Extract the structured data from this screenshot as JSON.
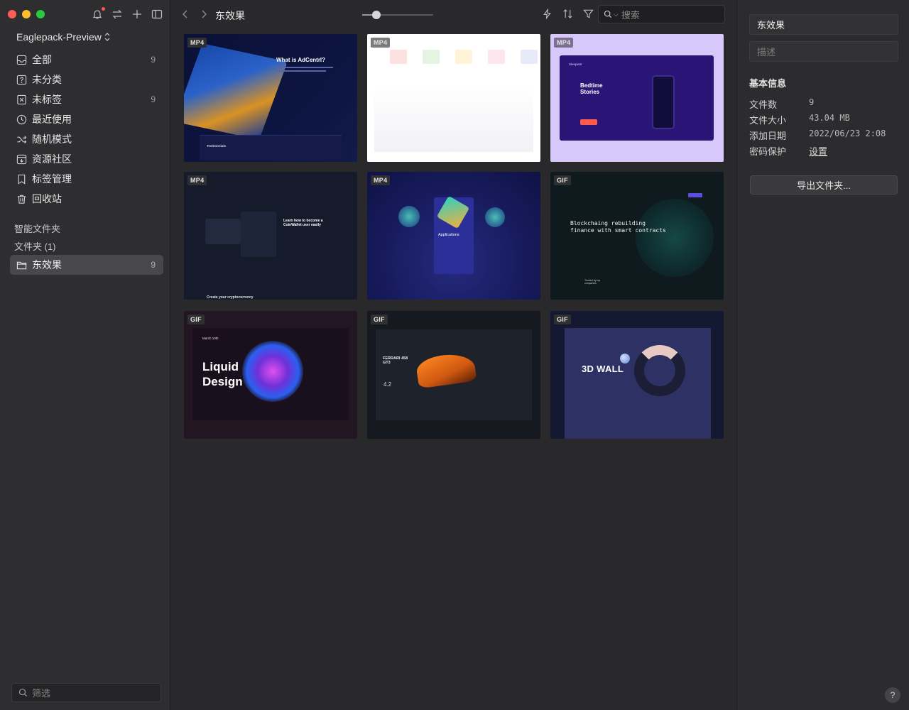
{
  "sidebar": {
    "library_name": "Eaglepack-Preview",
    "nav": [
      {
        "label": "全部",
        "count": "9",
        "icon": "inbox-icon"
      },
      {
        "label": "未分类",
        "count": "",
        "icon": "question-box-icon"
      },
      {
        "label": "未标签",
        "count": "9",
        "icon": "untagged-icon"
      },
      {
        "label": "最近使用",
        "count": "",
        "icon": "clock-icon"
      },
      {
        "label": "随机模式",
        "count": "",
        "icon": "shuffle-icon"
      },
      {
        "label": "资源社区",
        "count": "",
        "icon": "community-icon"
      },
      {
        "label": "标签管理",
        "count": "",
        "icon": "bookmark-icon"
      },
      {
        "label": "回收站",
        "count": "",
        "icon": "trash-icon"
      }
    ],
    "smart_folders_label": "智能文件夹",
    "folders_label": "文件夹 (1)",
    "folder": {
      "label": "东效果",
      "count": "9"
    },
    "filter_placeholder": "筛选"
  },
  "toolbar": {
    "title": "东效果",
    "search_placeholder": "搜索"
  },
  "thumbnails": [
    {
      "badge": "MP4",
      "heading": "What is AdCentrl?",
      "sub": "Testimonials"
    },
    {
      "badge": "MP4",
      "heading": "",
      "sub": ""
    },
    {
      "badge": "MP4",
      "heading": "Bedtime Stories",
      "sub": "Sleepiest"
    },
    {
      "badge": "MP4",
      "heading": "Learn how to become a CoinWallet user easily",
      "sub": "Create your cryptocurrency"
    },
    {
      "badge": "MP4",
      "heading": "Applications",
      "sub": ""
    },
    {
      "badge": "GIF",
      "heading": "Blockchaing rebuilding finance with smart contracts",
      "sub": "Trusted by top companies"
    },
    {
      "badge": "GIF",
      "heading": "Liquid Design",
      "sub": "March 10th"
    },
    {
      "badge": "GIF",
      "heading": "FERRARI 458 GT3",
      "sub": "4.2"
    },
    {
      "badge": "GIF",
      "heading": "3D WALL",
      "sub": ""
    }
  ],
  "info": {
    "name_value": "东效果",
    "desc_placeholder": "描述",
    "section_title": "基本信息",
    "rows": [
      {
        "key": "文件数",
        "value": "9"
      },
      {
        "key": "文件大小",
        "value": "43.04 MB"
      },
      {
        "key": "添加日期",
        "value": "2022/06/23 2:08"
      },
      {
        "key": "密码保护",
        "value": "设置"
      }
    ],
    "export_label": "导出文件夹...",
    "help_label": "?"
  }
}
